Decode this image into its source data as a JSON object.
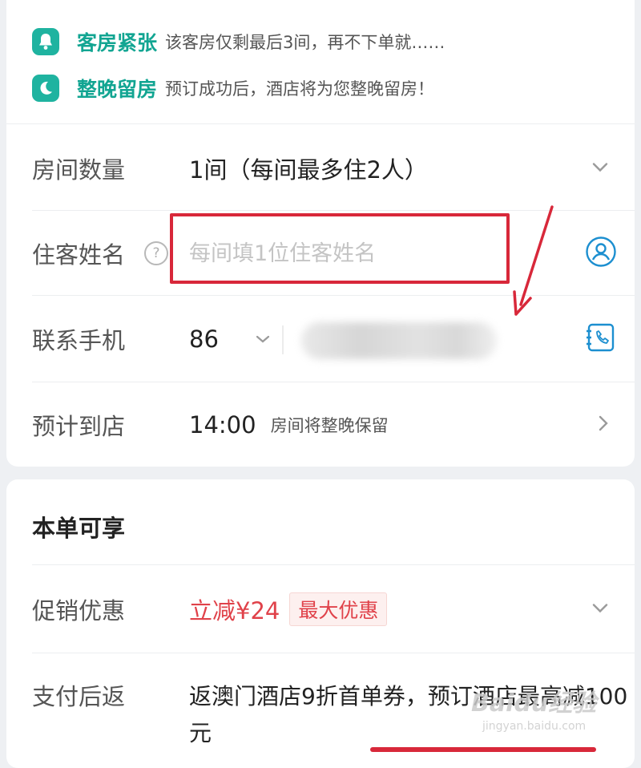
{
  "notices": [
    {
      "icon": "bell-icon",
      "title": "客房紧张",
      "text": "该客房仅剩最后3间，再不下单就……"
    },
    {
      "icon": "moon-icon",
      "title": "整晚留房",
      "text": "预订成功后，酒店将为您整晚留房！"
    }
  ],
  "form": {
    "rooms": {
      "label": "房间数量",
      "value": "1间（每间最多住2人）"
    },
    "guest": {
      "label": "住客姓名",
      "help": "?",
      "placeholder": "每间填1位住客姓名"
    },
    "phone": {
      "label": "联系手机",
      "country_code": "86"
    },
    "arrival": {
      "label": "预计到店",
      "time": "14:00",
      "note": "房间将整晚保留"
    }
  },
  "benefits": {
    "title": "本单可享",
    "promo": {
      "label": "促销优惠",
      "amount": "立减¥24",
      "badge": "最大优惠"
    },
    "cashback": {
      "label": "支付后返",
      "text": "返澳门酒店9折首单券，预订酒店最高减100元"
    }
  },
  "watermark": {
    "brand": "Baidu经验",
    "url": "jingyan.baidu.com"
  },
  "colors": {
    "accent_teal": "#12a592",
    "promo_red": "#e0424a",
    "highlight_red": "#d8283a"
  }
}
